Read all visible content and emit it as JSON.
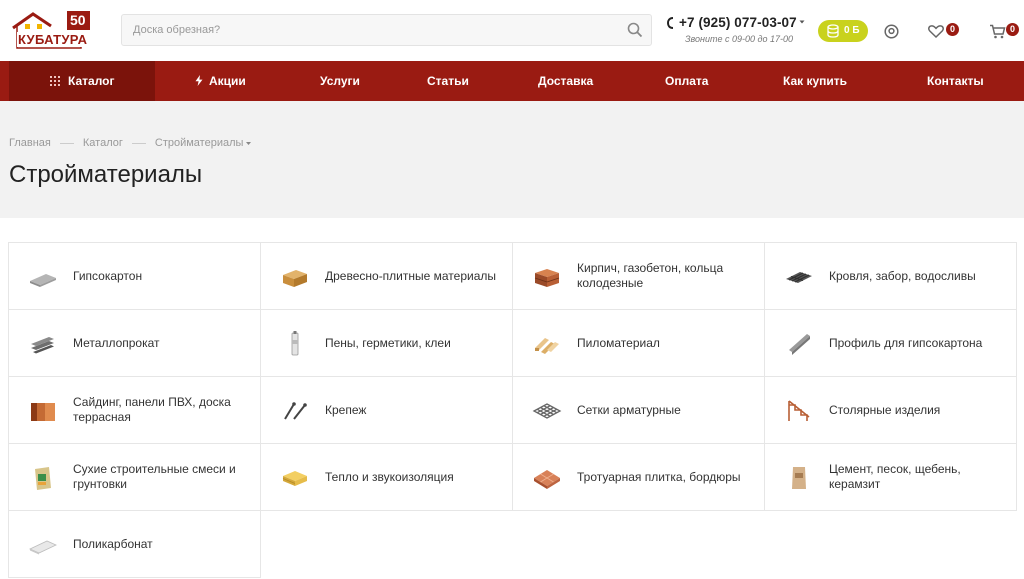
{
  "header": {
    "logo": {
      "badge": "50",
      "text": "КУБАТУРА"
    },
    "search": {
      "placeholder": "Доска обрезная?"
    },
    "phone": "+7 (925) 077-03-07",
    "hours": "Звоните с 09-00 до 17-00",
    "bonus": "0 Б",
    "favorites_count": "0",
    "cart_count": "0",
    "colors": {
      "brand": "#9a1b12",
      "bonus": "#c9d21d"
    }
  },
  "nav": {
    "items": [
      {
        "label": "Каталог"
      },
      {
        "label": "Акции"
      },
      {
        "label": "Услуги"
      },
      {
        "label": "Статьи"
      },
      {
        "label": "Доставка"
      },
      {
        "label": "Оплата"
      },
      {
        "label": "Как купить"
      },
      {
        "label": "Контакты"
      }
    ]
  },
  "breadcrumb": [
    "Главная",
    "Каталог",
    "Стройматериалы"
  ],
  "page_title": "Стройматериалы",
  "categories": [
    {
      "label": "Гипсокартон",
      "icon": "drywall-icon"
    },
    {
      "label": "Древесно-плитные материалы",
      "icon": "wood-board-icon"
    },
    {
      "label": "Кирпич, газобетон, кольца колодезные",
      "icon": "brick-icon"
    },
    {
      "label": "Кровля, забор, водосливы",
      "icon": "roofing-icon"
    },
    {
      "label": "Металлопрокат",
      "icon": "metal-profile-icon"
    },
    {
      "label": "Пены, герметики, клеи",
      "icon": "sealant-tube-icon"
    },
    {
      "label": "Пиломатериал",
      "icon": "lumber-icon"
    },
    {
      "label": "Профиль для гипсокартона",
      "icon": "drywall-profile-icon"
    },
    {
      "label": "Сайдинг, панели ПВХ, доска террасная",
      "icon": "siding-icon"
    },
    {
      "label": "Крепеж",
      "icon": "fastener-icon"
    },
    {
      "label": "Сетки арматурные",
      "icon": "mesh-icon"
    },
    {
      "label": "Столярные изделия",
      "icon": "stairs-icon"
    },
    {
      "label": "Сухие строительные смеси и грунтовки",
      "icon": "dry-mix-bag-icon"
    },
    {
      "label": "Тепло и звукоизоляция",
      "icon": "insulation-icon"
    },
    {
      "label": "Тротуарная плитка, бордюры",
      "icon": "paving-tile-icon"
    },
    {
      "label": "Цемент, песок, щебень, керамзит",
      "icon": "cement-bag-icon"
    },
    {
      "label": "Поликарбонат",
      "icon": "polycarbonate-icon"
    }
  ]
}
